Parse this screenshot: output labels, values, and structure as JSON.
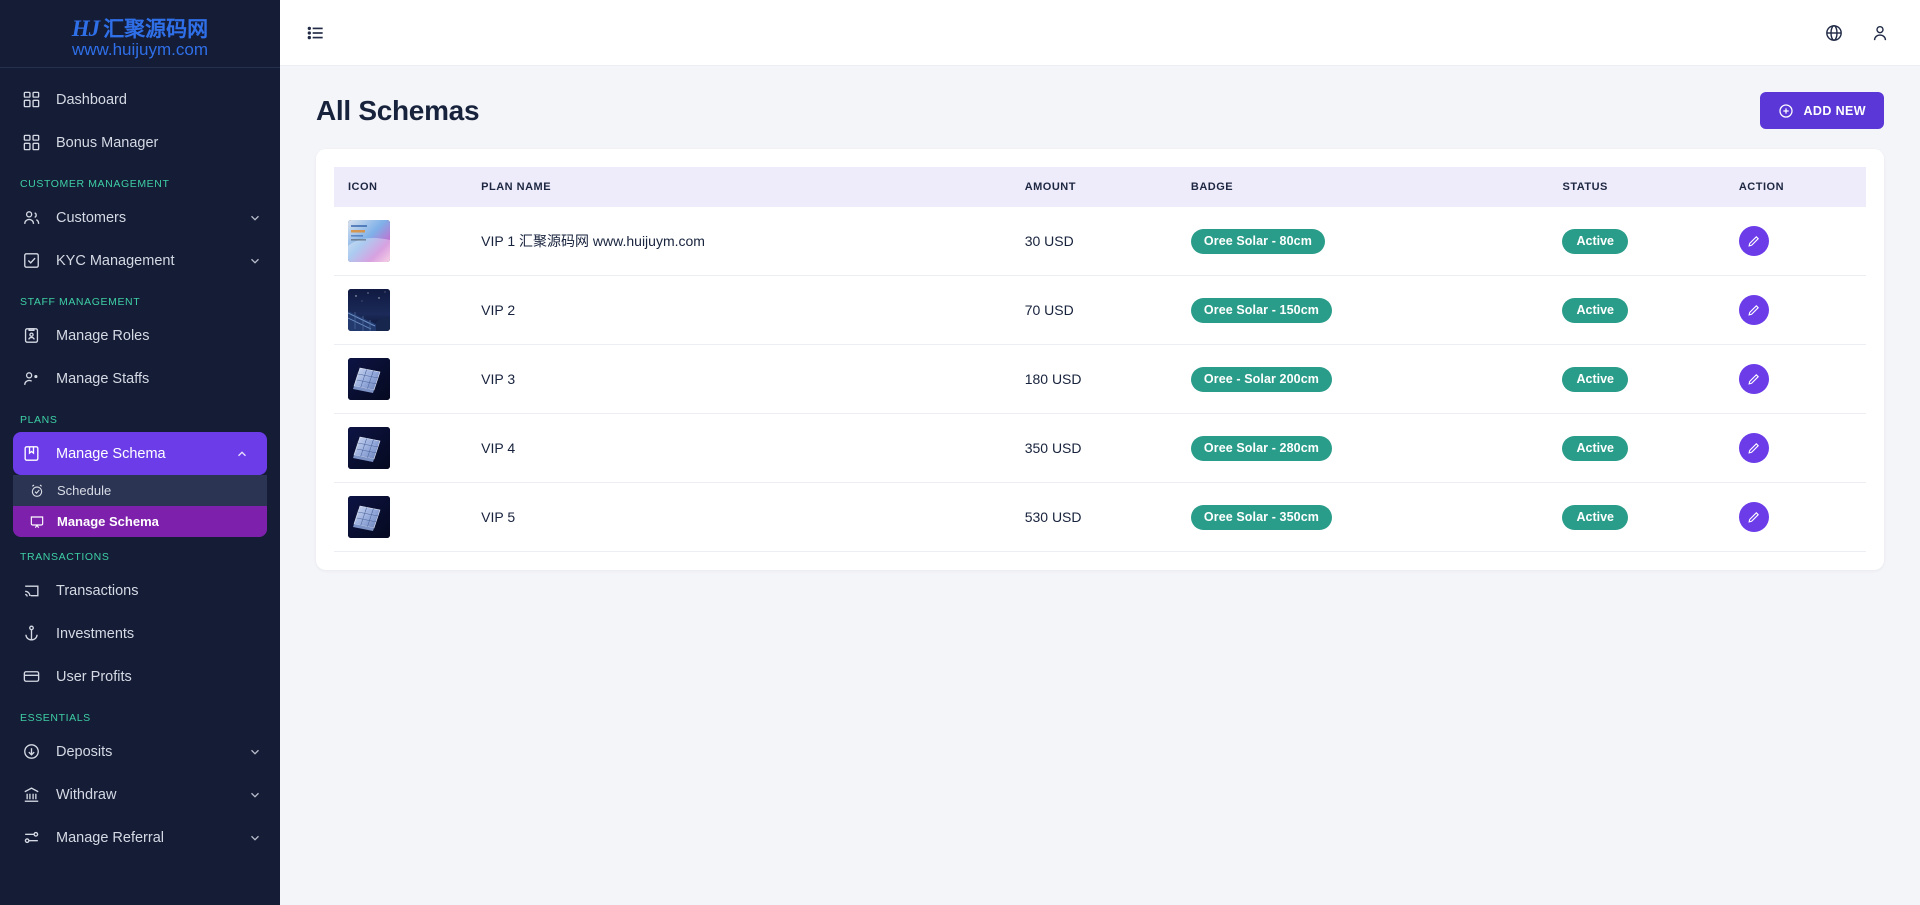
{
  "brand": {
    "hj": "HJ",
    "chinese": "汇聚源码网",
    "url": "www.huijuym.com"
  },
  "sidebar": {
    "top_items": [
      {
        "label": "Dashboard",
        "icon": "grid-icon"
      },
      {
        "label": "Bonus Manager",
        "icon": "grid-icon"
      }
    ],
    "sections": [
      {
        "label": "CUSTOMER MANAGEMENT",
        "items": [
          {
            "label": "Customers",
            "icon": "users-icon",
            "expandable": true
          },
          {
            "label": "KYC Management",
            "icon": "check-square-icon",
            "expandable": true
          }
        ]
      },
      {
        "label": "STAFF MANAGEMENT",
        "items": [
          {
            "label": "Manage Roles",
            "icon": "id-card-icon",
            "expandable": false
          },
          {
            "label": "Manage Staffs",
            "icon": "user-cog-icon",
            "expandable": false
          }
        ]
      },
      {
        "label": "PLANS",
        "items": [
          {
            "label": "Manage Schema",
            "icon": "bookmark-box-icon",
            "expandable": true,
            "active": true
          }
        ],
        "submenu": [
          {
            "label": "Schedule",
            "icon": "alarm-check-icon",
            "selected": false
          },
          {
            "label": "Manage Schema",
            "icon": "presentation-icon",
            "selected": true
          }
        ]
      },
      {
        "label": "TRANSACTIONS",
        "items": [
          {
            "label": "Transactions",
            "icon": "cast-icon",
            "expandable": false
          },
          {
            "label": "Investments",
            "icon": "anchor-icon",
            "expandable": false
          },
          {
            "label": "User Profits",
            "icon": "credit-card-icon",
            "expandable": false
          }
        ]
      },
      {
        "label": "ESSENTIALS",
        "items": [
          {
            "label": "Deposits",
            "icon": "arrow-down-circle-icon",
            "expandable": true
          },
          {
            "label": "Withdraw",
            "icon": "bank-icon",
            "expandable": true
          },
          {
            "label": "Manage Referral",
            "icon": "sliders-icon",
            "expandable": true
          }
        ]
      }
    ]
  },
  "topbar": {
    "menu_icon": "list-icon",
    "language_icon": "globe-icon",
    "profile_icon": "user-icon"
  },
  "page": {
    "title": "All Schemas",
    "add_new_label": "ADD NEW",
    "add_new_icon": "plus-circle-icon"
  },
  "table": {
    "columns": [
      "ICON",
      "PLAN NAME",
      "AMOUNT",
      "BADGE",
      "STATUS",
      "ACTION"
    ],
    "rows": [
      {
        "icon": "plan-thumbnail-gradient",
        "plan_name": "VIP 1 汇聚源码网 www.huijuym.com",
        "amount": "30 USD",
        "badge": "Oree Solar - 80cm",
        "status": "Active",
        "action_icon": "edit-pencil-icon"
      },
      {
        "icon": "plan-thumbnail-solar-night",
        "plan_name": "VIP 2",
        "amount": "70 USD",
        "badge": "Oree Solar - 150cm",
        "status": "Active",
        "action_icon": "edit-pencil-icon"
      },
      {
        "icon": "plan-thumbnail-solar-panel",
        "plan_name": "VIP 3",
        "amount": "180 USD",
        "badge": "Oree - Solar 200cm",
        "status": "Active",
        "action_icon": "edit-pencil-icon"
      },
      {
        "icon": "plan-thumbnail-solar-panel",
        "plan_name": "VIP 4",
        "amount": "350 USD",
        "badge": "Oree Solar - 280cm",
        "status": "Active",
        "action_icon": "edit-pencil-icon"
      },
      {
        "icon": "plan-thumbnail-solar-panel",
        "plan_name": "VIP 5",
        "amount": "530 USD",
        "badge": "Oree Solar - 350cm",
        "status": "Active",
        "action_icon": "edit-pencil-icon"
      }
    ]
  },
  "colors": {
    "sidebar_bg": "#141c36",
    "accent_purple": "#6c3ce9",
    "submenu_selected": "#7d20ab",
    "badge_green": "#2a9d8a",
    "section_label": "#3ecfa5",
    "brand_blue": "#2f6fe8",
    "table_header_bg": "#eeebfa"
  }
}
